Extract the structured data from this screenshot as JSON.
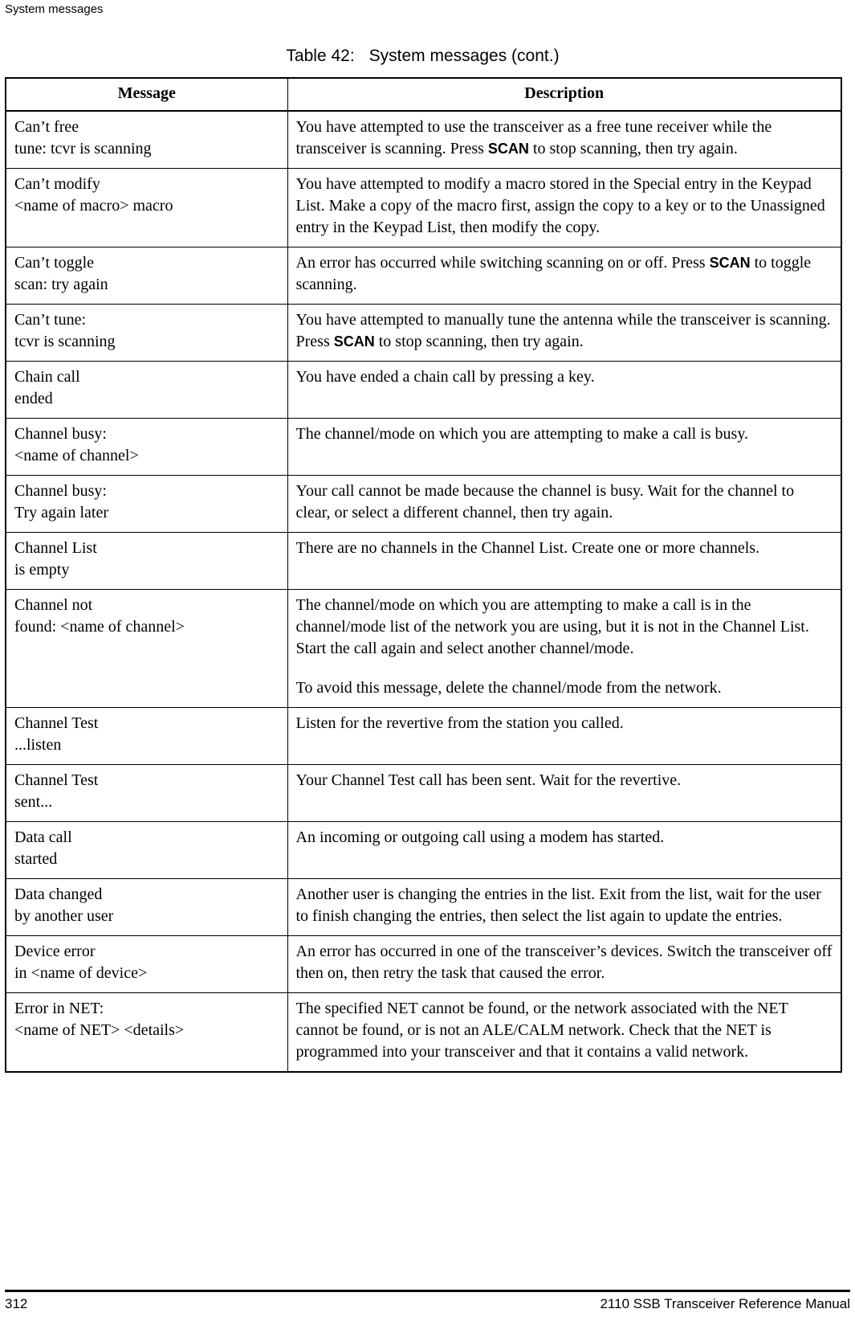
{
  "page": {
    "running_head": "System messages",
    "footer_page_number": "312",
    "footer_manual_title": "2110 SSB Transceiver Reference Manual"
  },
  "table": {
    "caption_label": "Table 42:",
    "caption_title": "System messages (cont.)",
    "columns": [
      {
        "header": "Message"
      },
      {
        "header": "Description"
      }
    ],
    "rows": [
      {
        "message_lines": [
          "Can’t free",
          "tune: tcvr is scanning"
        ],
        "description": [
          [
            {
              "t": "You have attempted to use the transceiver as a free tune receiver while the transceiver is scanning. Press "
            },
            {
              "t": "SCAN",
              "kbd": true
            },
            {
              "t": " to stop scanning, then try again."
            }
          ]
        ]
      },
      {
        "message_lines": [
          "Can’t modify",
          "<name of macro> macro"
        ],
        "description": [
          [
            {
              "t": "You have attempted to modify a macro stored in the Special entry in the Keypad List. Make a copy of the macro first, assign the copy to a key or to the Unassigned entry in the Keypad List, then modify the copy."
            }
          ]
        ]
      },
      {
        "message_lines": [
          "Can’t toggle",
          "scan: try again"
        ],
        "description": [
          [
            {
              "t": "An error has occurred while switching scanning on or off. Press "
            },
            {
              "t": "SCAN",
              "kbd": true
            },
            {
              "t": " to toggle scanning."
            }
          ]
        ]
      },
      {
        "message_lines": [
          "Can’t tune:",
          "tcvr is scanning"
        ],
        "description": [
          [
            {
              "t": "You have attempted to manually tune the antenna while the transceiver is scanning. Press "
            },
            {
              "t": "SCAN",
              "kbd": true
            },
            {
              "t": " to stop scanning, then try again."
            }
          ]
        ]
      },
      {
        "message_lines": [
          "Chain call",
          "ended"
        ],
        "description": [
          [
            {
              "t": "You have ended a chain call by pressing a key."
            }
          ]
        ]
      },
      {
        "message_lines": [
          "Channel busy:",
          "<name of channel>"
        ],
        "description": [
          [
            {
              "t": "The channel/mode on which you are attempting to make a call is busy."
            }
          ]
        ]
      },
      {
        "message_lines": [
          "Channel busy:",
          "Try again later"
        ],
        "description": [
          [
            {
              "t": "Your call cannot be made because the channel is busy. Wait for the channel to clear, or select a different channel, then try again."
            }
          ]
        ]
      },
      {
        "message_lines": [
          "Channel List",
          "is empty"
        ],
        "description": [
          [
            {
              "t": "There are no channels in the Channel List. Create one or more channels."
            }
          ]
        ]
      },
      {
        "message_lines": [
          "Channel not",
          "found: <name of channel>"
        ],
        "description": [
          [
            {
              "t": "The channel/mode on which you are attempting to make a call is in the channel/mode list of the network you are using, but it is not in the Channel List. Start the call again and select another channel/mode."
            }
          ],
          [
            {
              "t": "To avoid this message, delete the channel/mode from the network."
            }
          ]
        ]
      },
      {
        "message_lines": [
          "Channel Test",
          "...listen"
        ],
        "description": [
          [
            {
              "t": "Listen for the revertive from the station you called."
            }
          ]
        ]
      },
      {
        "message_lines": [
          "Channel Test",
          "sent..."
        ],
        "description": [
          [
            {
              "t": "Your Channel Test call has been sent. Wait for the revertive."
            }
          ]
        ]
      },
      {
        "message_lines": [
          "Data call",
          "started"
        ],
        "description": [
          [
            {
              "t": "An incoming or outgoing call using a modem has started."
            }
          ]
        ]
      },
      {
        "message_lines": [
          "Data changed",
          "by another user"
        ],
        "description": [
          [
            {
              "t": "Another user is changing the entries in the list. Exit from the list, wait for the user to finish changing the entries, then select the list again to update the entries."
            }
          ]
        ]
      },
      {
        "message_lines": [
          "Device error",
          "in <name of device>"
        ],
        "description": [
          [
            {
              "t": "An error has occurred in one of the transceiver’s devices. Switch the transceiver off then on, then retry the task that caused the error."
            }
          ]
        ]
      },
      {
        "message_lines": [
          "Error in NET:",
          "<name of NET> <details>"
        ],
        "description": [
          [
            {
              "t": "The specified NET cannot be found, or the network associated with the NET cannot be found, or is not an ALE/CALM network. Check that the NET is programmed into your transceiver and that it contains a valid network."
            }
          ]
        ]
      }
    ]
  }
}
